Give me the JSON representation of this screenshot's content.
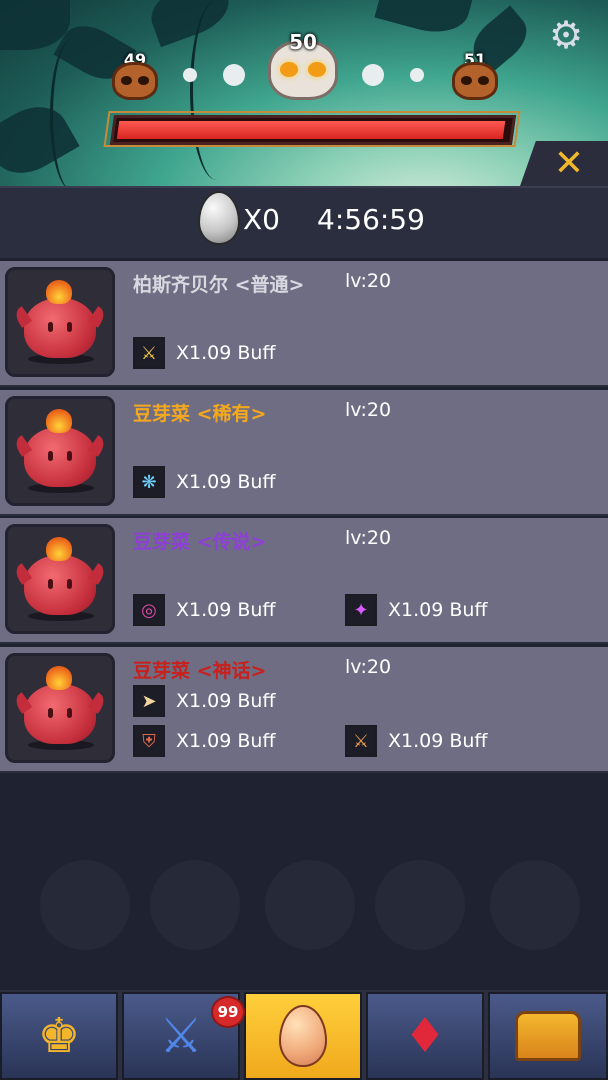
{
  "header": {
    "levels": {
      "prev": "49",
      "current": "50",
      "next": "51"
    },
    "hp_fraction": 0.99
  },
  "info": {
    "egg_count": "X0",
    "timer": "4:56:59"
  },
  "rows": [
    {
      "name": "柏斯齐贝尔 <普通>",
      "name_color": "#d8d8e0",
      "level": "lv:20",
      "buffs": [
        {
          "icon": "sword-icon",
          "text": "X1.09 Buff"
        }
      ]
    },
    {
      "name": "豆芽菜 <稀有>",
      "name_color": "#f4a81e",
      "level": "lv:20",
      "buffs": [
        {
          "icon": "shield-burst-icon",
          "text": "X1.09 Buff"
        }
      ]
    },
    {
      "name": "豆芽菜 <传说>",
      "name_color": "#8e3fd6",
      "level": "lv:20",
      "buffs": [
        {
          "icon": "sun-orb-icon",
          "text": "X1.09 Buff"
        },
        {
          "icon": "magic-sword-icon",
          "text": "X1.09 Buff"
        }
      ]
    },
    {
      "name": "豆芽菜 <神话>",
      "name_color": "#c8201c",
      "level": "lv:20",
      "buffs": [
        {
          "icon": "bow-icon",
          "text": "X1.09 Buff"
        },
        {
          "icon": "crest-shield-icon",
          "text": "X1.09 Buff"
        },
        {
          "icon": "crossed-swords-icon",
          "text": "X1.09 Buff"
        }
      ]
    }
  ],
  "tabs": [
    {
      "icon": "helmet-icon"
    },
    {
      "icon": "sword-shield-icon",
      "badge": "99"
    },
    {
      "icon": "egg-icon",
      "active": true
    },
    {
      "icon": "gem-crest-icon"
    },
    {
      "icon": "treasure-chest-icon"
    }
  ]
}
